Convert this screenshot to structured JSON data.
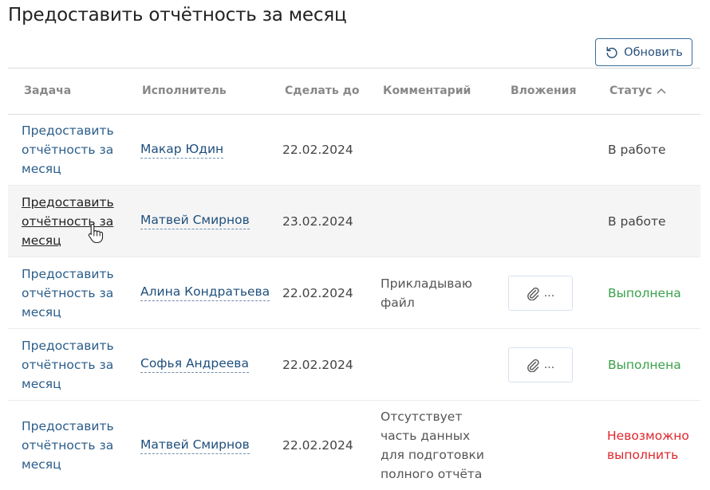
{
  "page": {
    "title": "Предоставить отчётность за месяц"
  },
  "toolbar": {
    "refresh_label": "Обновить"
  },
  "table": {
    "headers": {
      "task": "Задача",
      "assignee": "Исполнитель",
      "due": "Сделать до",
      "comment": "Комментарий",
      "attachments": "Вложения",
      "status": "Статус"
    },
    "rows": [
      {
        "task": "Предоставить отчётность за месяц",
        "assignee": "Макар Юдин",
        "due": "22.02.2024",
        "comment": "",
        "attachment": "",
        "status": "В работе"
      },
      {
        "task": "Предоставить отчётность за месяц",
        "assignee": "Матвей Смирнов",
        "due": "23.02.2024",
        "comment": "",
        "attachment": "",
        "status": "В работе"
      },
      {
        "task": "Предоставить отчётность за месяц",
        "assignee": "Алина Кондратьева",
        "due": "22.02.2024",
        "comment": "Прикладываю файл",
        "attachment": "...",
        "status": "Выполнена"
      },
      {
        "task": "Предоставить отчётность за месяц",
        "assignee": "Софья Андреева",
        "due": "22.02.2024",
        "comment": "",
        "attachment": "...",
        "status": "Выполнена"
      },
      {
        "task": "Предоставить отчётность за месяц",
        "assignee": "Матвей Смирнов",
        "due": "22.02.2024",
        "comment": "Отсутствует часть данных для подготовки полного отчёта",
        "attachment": "",
        "status": "Невозможно выполнить"
      }
    ]
  },
  "colors": {
    "link": "#2a5d8a",
    "done": "#3aa14a",
    "fail": "#e0262b",
    "button_border": "#3b6d95"
  }
}
